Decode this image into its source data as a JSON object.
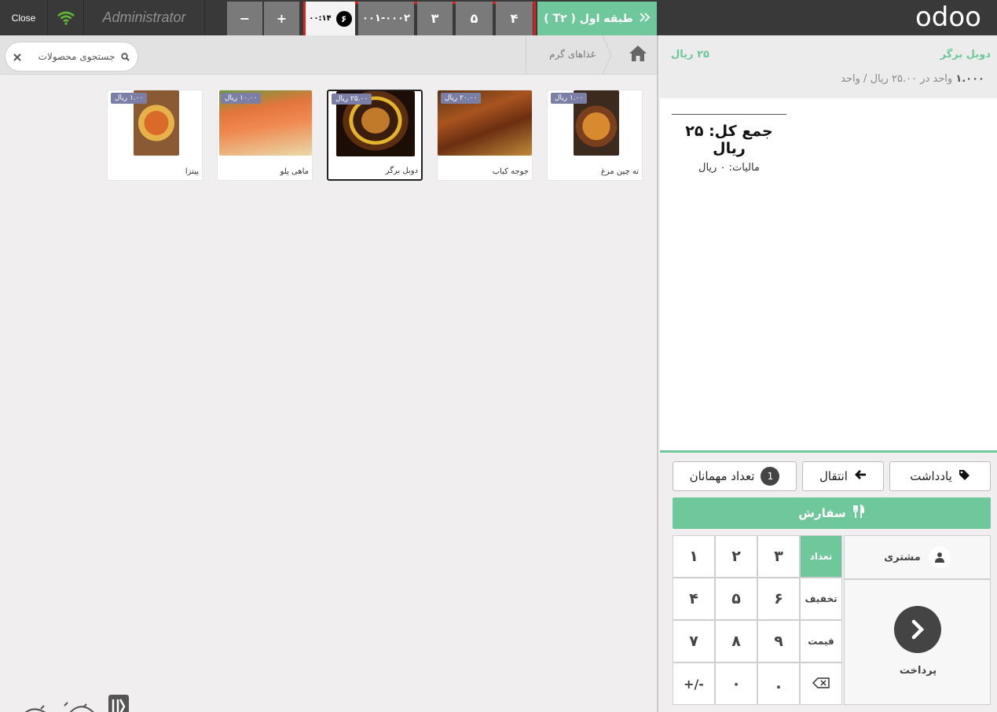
{
  "header": {
    "close_label": "Close",
    "user_name": "Administrator",
    "minus_label": "−",
    "plus_label": "+",
    "order_tabs": [
      {
        "label": "۰۰:۱۴",
        "count": "۶",
        "selected": true
      },
      {
        "label": "۰۰۱-۰۰۰۲"
      },
      {
        "label": "۳"
      },
      {
        "label": "۵"
      },
      {
        "label": "۴"
      }
    ],
    "floor_label": "طبقه اول ( T۲ )",
    "logo_text": "odoo"
  },
  "breadcrumb": {
    "category": "غذاهای گرم"
  },
  "search": {
    "placeholder": "جستجوی محصولات"
  },
  "products": [
    {
      "name": "ته چین مرغ",
      "price": "۱.۰۰ ریال"
    },
    {
      "name": "جوجه کباب",
      "price": "۲۰.۰۰ ریال"
    },
    {
      "name": "دوبل برگر",
      "price": "۲۵.۰۰ ریال",
      "selected": true
    },
    {
      "name": "ماهی پلو",
      "price": "۱۰.۰۰ ریال"
    },
    {
      "name": "پیتزا",
      "price": "۱.۰۰ ریال"
    }
  ],
  "order": {
    "line_name": "دوبل برگر",
    "line_price": "۲۵ ریال",
    "line_qty": "۱.۰۰۰",
    "line_unit_info": "واحد در ۲۵.۰۰ ریال / واحد",
    "total": "جمع کل: ۲۵ ریال",
    "tax": "مالیات: ۰ ریال"
  },
  "controls": {
    "guests_label": "تعداد مهمانان",
    "guests_count": "1",
    "transfer_label": "انتقال",
    "note_label": "یادداشت",
    "order_label": "سفارش",
    "customer_label": "مشتری",
    "payment_label": "پرداخت",
    "modes": {
      "qty": "تعداد",
      "disc": "تخفیف",
      "price": "قیمت"
    },
    "keys": [
      "۱",
      "۲",
      "۳",
      "۴",
      "۵",
      "۶",
      "۷",
      "۸",
      "۹",
      "+/-",
      "۰",
      "."
    ]
  },
  "colors": {
    "accent": "#6ec89b",
    "header_bg": "#393939",
    "highlight_box": "#e0221e",
    "price_badge": "#7b7fa6"
  }
}
